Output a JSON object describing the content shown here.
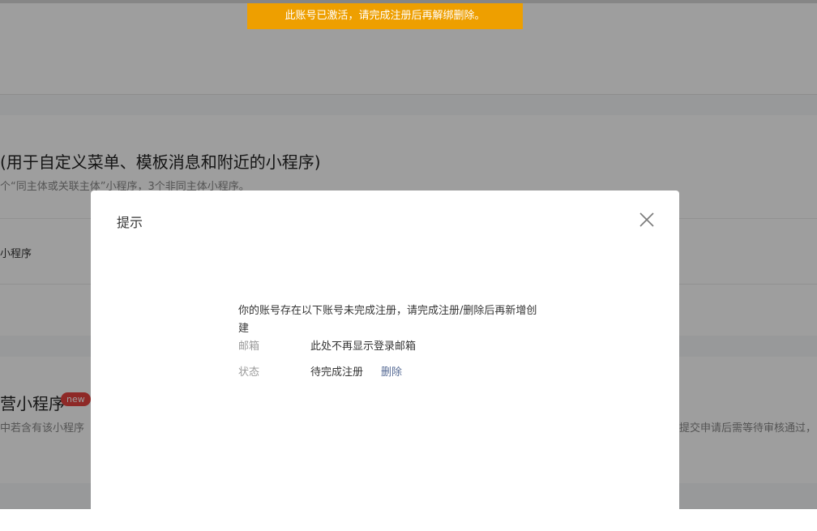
{
  "background": {
    "section1": {
      "title": "(用于自定义菜单、模板消息和附近的小程序)",
      "description": "个“同主体或关联主体”小程序，3个非同主体小程序。",
      "row_label": "小程序"
    },
    "section2": {
      "title": "营小程序",
      "badge": "new",
      "description_left": "中若含有该小程序",
      "description_right": "提交申请后需等待审核通过，"
    }
  },
  "banner": {
    "text": "此账号已激活，请完成注册后再解绑删除。",
    "color": "#ee9f00"
  },
  "dialog": {
    "title": "提示",
    "close_icon": "close-icon",
    "message": "你的账号存在以下账号未完成注册，请完成注册/删除后再新增创建",
    "rows": [
      {
        "key": "邮箱",
        "value": "此处不再显示登录邮箱"
      },
      {
        "key": "状态",
        "value": "待完成注册",
        "action": "删除"
      }
    ],
    "link_color": "#576b95"
  }
}
